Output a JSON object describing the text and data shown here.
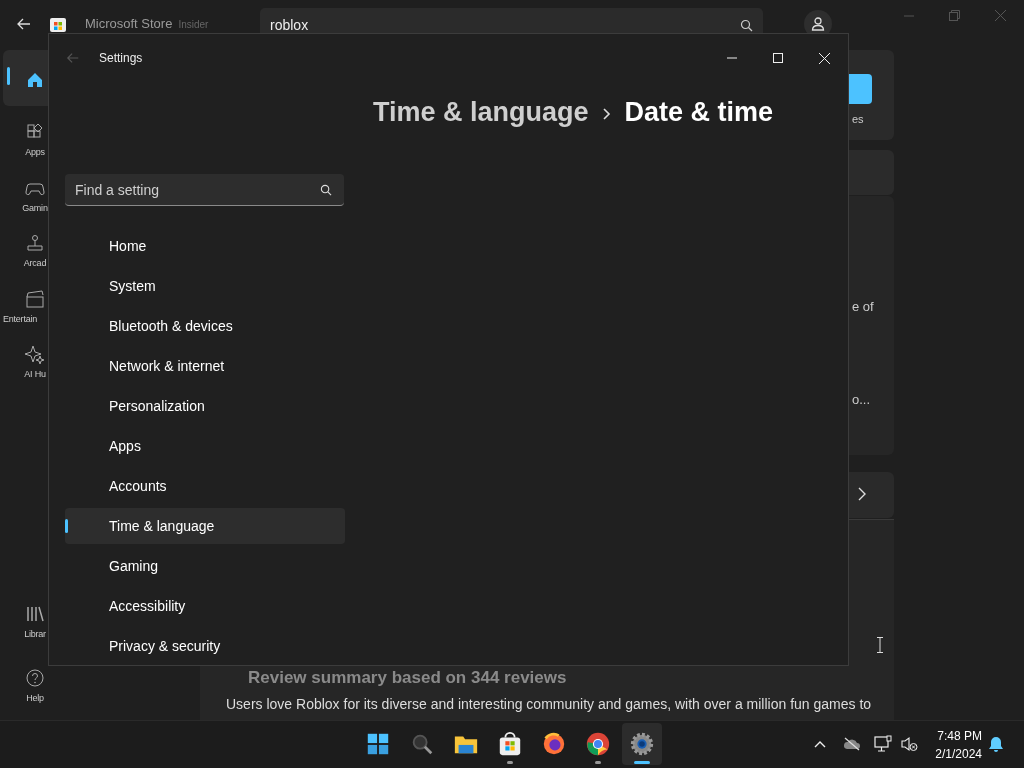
{
  "store": {
    "title": "Microsoft Store",
    "badge": "Insider",
    "search": {
      "value": "roblox"
    },
    "nav": [
      {
        "kind": "home",
        "selected": true
      },
      {
        "kind": "apps",
        "label": "Apps",
        "selected": false
      },
      {
        "kind": "gaming",
        "label": "Gamin",
        "selected": false
      },
      {
        "kind": "arcade",
        "label": "Arcad",
        "selected": false
      },
      {
        "kind": "entertainment",
        "label": "Entertain",
        "selected": false
      },
      {
        "kind": "ai",
        "label": "AI Hu",
        "selected": false
      }
    ],
    "nav_bottom": [
      {
        "kind": "library",
        "label": "Librar"
      },
      {
        "kind": "help",
        "label": "Help"
      }
    ],
    "fragments": [
      "es",
      "e of",
      "o..."
    ],
    "review_heading": "Review summary based on 344 reviews",
    "review_text": "Users love Roblox for its diverse and interesting community and games, with over a million fun games to"
  },
  "settings": {
    "title": "Settings",
    "breadcrumb": [
      "Time & language",
      "Date & time"
    ],
    "search": {
      "placeholder": "Find a setting"
    },
    "nav": [
      {
        "label": "Home",
        "selected": false
      },
      {
        "label": "System",
        "selected": false
      },
      {
        "label": "Bluetooth & devices",
        "selected": false
      },
      {
        "label": "Network & internet",
        "selected": false
      },
      {
        "label": "Personalization",
        "selected": false
      },
      {
        "label": "Apps",
        "selected": false
      },
      {
        "label": "Accounts",
        "selected": false
      },
      {
        "label": "Time & language",
        "selected": true
      },
      {
        "label": "Gaming",
        "selected": false
      },
      {
        "label": "Accessibility",
        "selected": false
      },
      {
        "label": "Privacy & security",
        "selected": false
      }
    ]
  },
  "taskbar": {
    "apps": [
      {
        "kind": "start",
        "active": false
      },
      {
        "kind": "search",
        "active": false
      },
      {
        "kind": "files",
        "active": false
      },
      {
        "kind": "store",
        "active": true
      },
      {
        "kind": "firefox",
        "active": false
      },
      {
        "kind": "chrome",
        "active": true
      },
      {
        "kind": "settings",
        "active": true
      }
    ],
    "time": "7:48 PM",
    "date": "2/1/2024"
  }
}
